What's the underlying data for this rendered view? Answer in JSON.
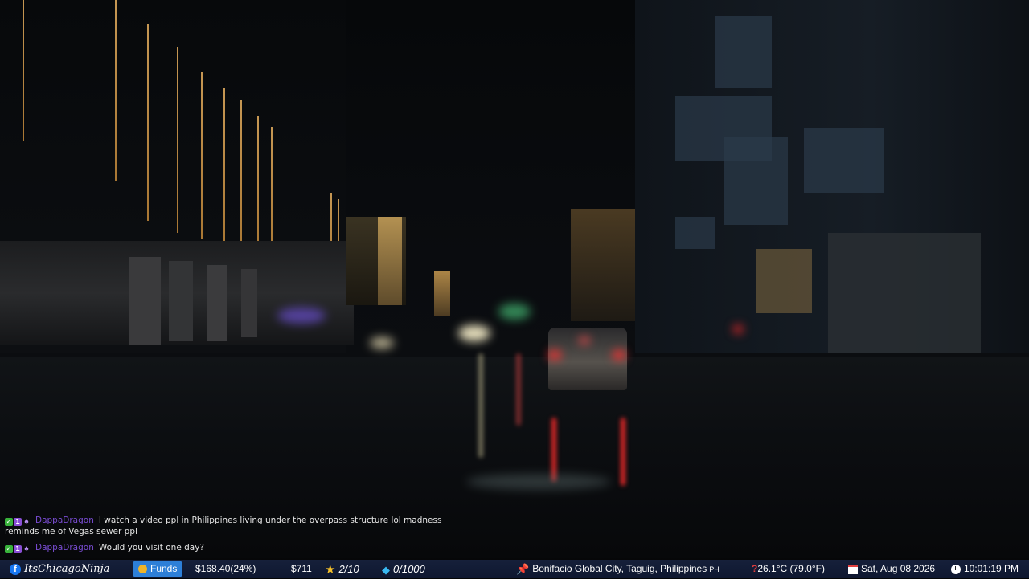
{
  "chat": {
    "messages": [
      {
        "username": "DappaDragon",
        "text": "I watch a video ppl in Philippines living under the overpass structure lol madness",
        "continuation": "reminds me of Vegas sewer ppl"
      },
      {
        "username": "DappaDragon",
        "text": "Would you visit one day?",
        "continuation": ""
      }
    ]
  },
  "statusbar": {
    "channel": "ItsChicagoNinja",
    "funds_label": "Funds",
    "funds_value": "$168.40(24%)",
    "money_value": "$711",
    "stars_value": "2/10",
    "gems_value": "0/1000",
    "location": "Bonifacio Global City, Taguig, Philippines",
    "country_code": "PH",
    "temperature": "26.1°C (79.0°F)",
    "date": "Sat, Aug 08 2026",
    "time": "10:01:19 PM"
  },
  "icons": {
    "facebook": "facebook-icon",
    "coin": "money-bag-icon",
    "star": "star-icon",
    "gem": "diamond-icon",
    "pin": "pushpin-icon",
    "weather": "question-icon",
    "calendar": "calendar-icon",
    "clock": "clock-icon"
  },
  "colors": {
    "statusbar_bg": "#16203a",
    "funds_bg": "#2d7fd8",
    "username": "#7a4dd4",
    "star": "#f6c12a",
    "gem": "#39b8f0",
    "pin": "#e23d3d"
  }
}
